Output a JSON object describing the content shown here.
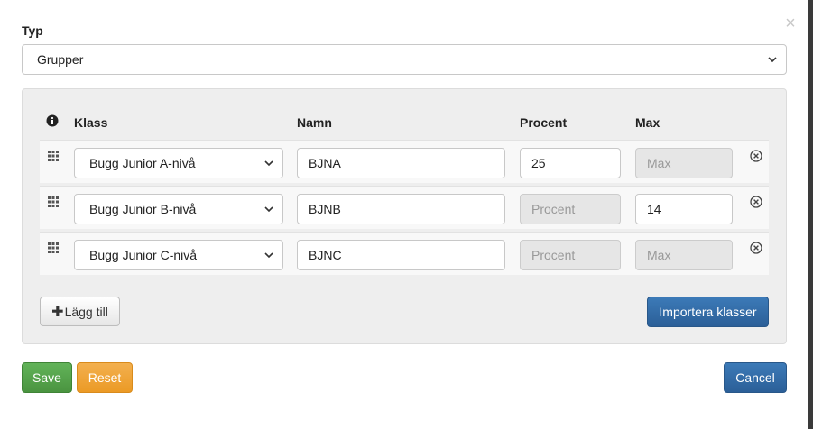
{
  "dialog": {
    "close_glyph": "×",
    "type_label": "Typ",
    "type_value": "Grupper"
  },
  "table": {
    "headers": {
      "klass": "Klass",
      "namn": "Namn",
      "procent": "Procent",
      "max": "Max"
    },
    "rows": [
      {
        "klass": "Bugg Junior A-nivå",
        "namn": "BJNA",
        "procent": "25",
        "procent_placeholder": "",
        "max": "",
        "max_placeholder": "Max"
      },
      {
        "klass": "Bugg Junior B-nivå",
        "namn": "BJNB",
        "procent": "",
        "procent_placeholder": "Procent",
        "max": "14",
        "max_placeholder": ""
      },
      {
        "klass": "Bugg Junior C-nivå",
        "namn": "BJNC",
        "procent": "",
        "procent_placeholder": "Procent",
        "max": "",
        "max_placeholder": "Max"
      }
    ]
  },
  "buttons": {
    "add_label": "Lägg till",
    "add_plus": "✚",
    "import_label": "Importera klasser",
    "save_label": "Save",
    "reset_label": "Reset",
    "cancel_label": "Cancel"
  },
  "icons": {
    "info": "info-icon",
    "grip": "drag-handle-icon",
    "remove": "remove-circle-icon",
    "chevron": "chevron-down-icon",
    "close": "close-icon"
  },
  "colors": {
    "primary": "#2b5f98",
    "success": "#4a9440",
    "warning": "#eb9a25"
  }
}
